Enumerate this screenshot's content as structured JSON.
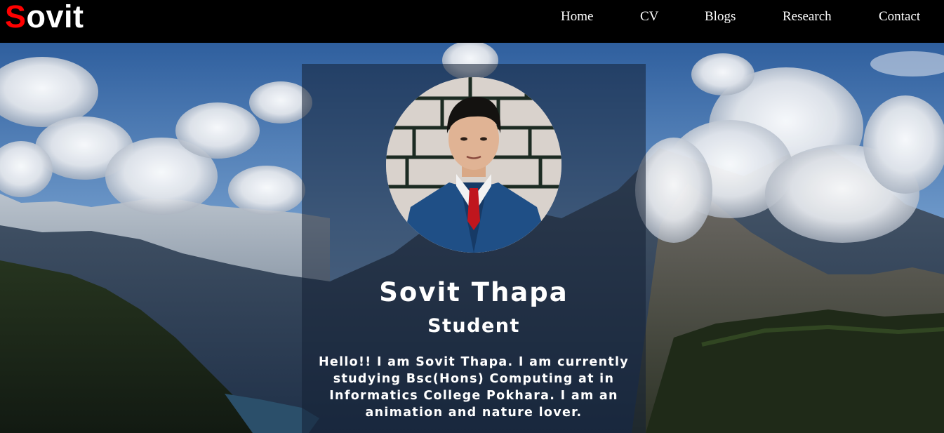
{
  "brand": {
    "first_letter": "S",
    "rest": "ovit",
    "first_letter_color": "#ff0000"
  },
  "nav": {
    "items": [
      {
        "label": "Home"
      },
      {
        "label": "CV"
      },
      {
        "label": "Blogs"
      },
      {
        "label": "Research"
      },
      {
        "label": "Contact"
      }
    ]
  },
  "hero": {
    "background": "mountain-landscape-photo",
    "profile": {
      "photo": "profile-photo",
      "name": "Sovit Thapa",
      "role": "Student",
      "bio": "Hello!! I am Sovit Thapa. I am currently studying Bsc(Hons) Computing at in Informatics College Pokhara. I am an animation and nature lover."
    }
  },
  "colors": {
    "navbar_bg": "#000000",
    "text": "#ffffff",
    "accent": "#ff0000"
  }
}
